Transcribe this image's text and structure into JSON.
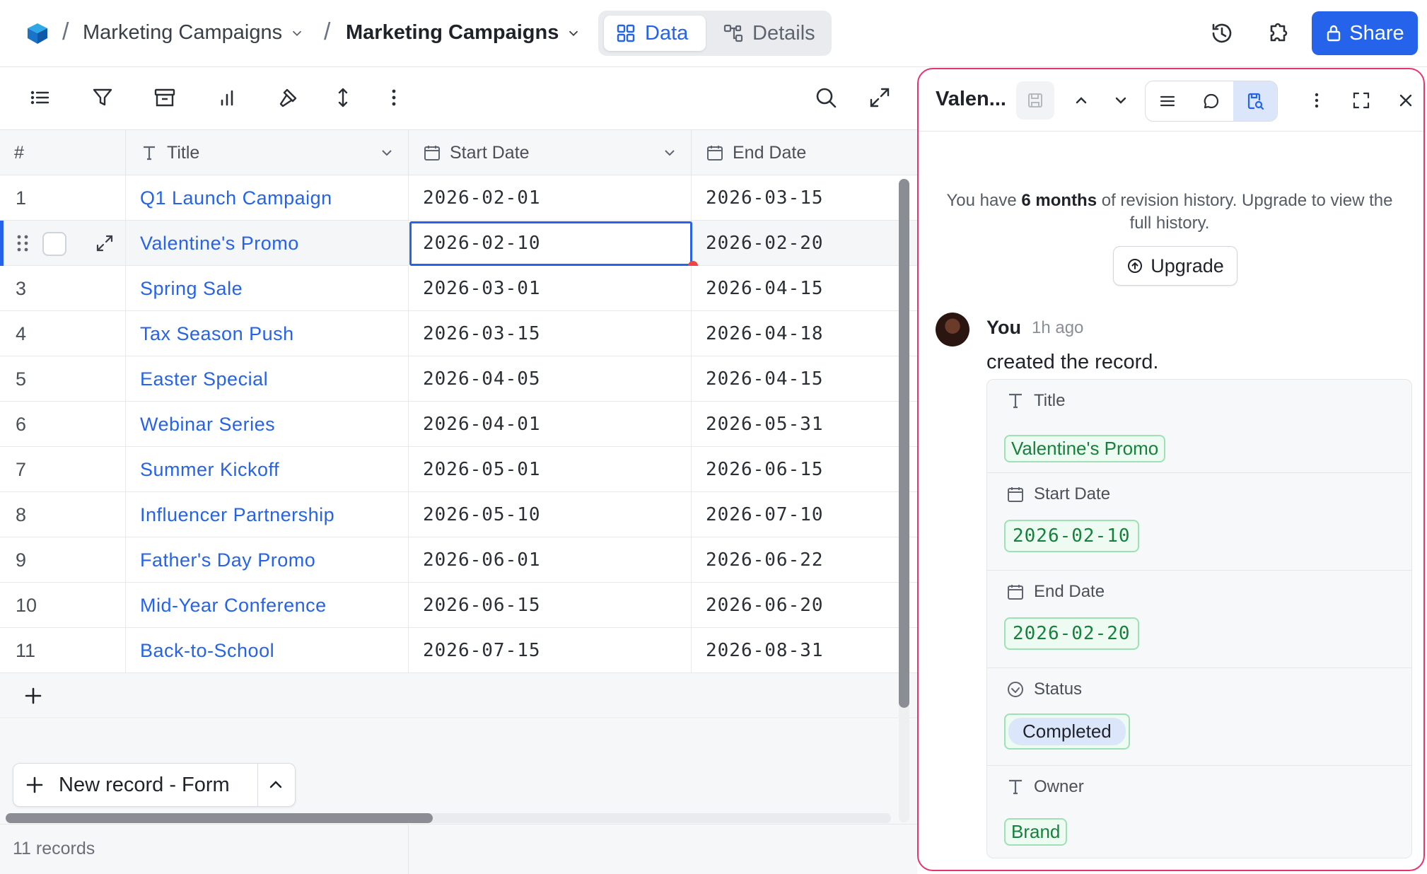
{
  "breadcrumb": {
    "base": "Marketing Campaigns",
    "table": "Marketing Campaigns"
  },
  "view_tabs": [
    {
      "label": "Data",
      "active": true
    },
    {
      "label": "Details",
      "active": false
    }
  ],
  "header_actions": {
    "share_label": "Share"
  },
  "colors": {
    "accent": "#2563eb",
    "panel_border": "#e8336f",
    "tag_green": "#16803c",
    "selection_dot": "#ef4444"
  },
  "toolbar_icons": [
    "fields-icon",
    "filter-icon",
    "group-icon",
    "chart-icon",
    "build-icon",
    "sort-icon",
    "more-icon",
    "search-icon",
    "fullscreen-icon"
  ],
  "columns": [
    {
      "key": "num",
      "label": "#"
    },
    {
      "key": "title",
      "label": "Title"
    },
    {
      "key": "start",
      "label": "Start Date"
    },
    {
      "key": "end",
      "label": "End Date"
    }
  ],
  "rows": [
    {
      "num": "1",
      "title": "Q1 Launch Campaign",
      "start": "2026-02-01",
      "end": "2026-03-15"
    },
    {
      "num": "2",
      "title": "Valentine's Promo",
      "start": "2026-02-10",
      "end": "2026-02-20"
    },
    {
      "num": "3",
      "title": "Spring Sale",
      "start": "2026-03-01",
      "end": "2026-04-15"
    },
    {
      "num": "4",
      "title": "Tax Season Push",
      "start": "2026-03-15",
      "end": "2026-04-18"
    },
    {
      "num": "5",
      "title": "Easter Special",
      "start": "2026-04-05",
      "end": "2026-04-15"
    },
    {
      "num": "6",
      "title": "Webinar Series",
      "start": "2026-04-01",
      "end": "2026-05-31"
    },
    {
      "num": "7",
      "title": "Summer Kickoff",
      "start": "2026-05-01",
      "end": "2026-06-15"
    },
    {
      "num": "8",
      "title": "Influencer Partnership",
      "start": "2026-05-10",
      "end": "2026-07-10"
    },
    {
      "num": "9",
      "title": "Father's Day Promo",
      "start": "2026-06-01",
      "end": "2026-06-22"
    },
    {
      "num": "10",
      "title": "Mid-Year Conference",
      "start": "2026-06-15",
      "end": "2026-06-20"
    },
    {
      "num": "11",
      "title": "Back-to-School",
      "start": "2026-07-15",
      "end": "2026-08-31"
    }
  ],
  "selected_row": 2,
  "new_record_label": "New record - Form",
  "footer": {
    "record_count": "11 records"
  },
  "panel": {
    "title": "Valen...",
    "revision_note_pre": "You have ",
    "revision_note_bold": "6 months",
    "revision_note_post": " of revision history. Upgrade to view the full history.",
    "upgrade_label": "Upgrade",
    "activity": {
      "user": "You",
      "time": "1h ago",
      "action": "created the record."
    },
    "changes": [
      {
        "field": "Title",
        "icon": "text-icon",
        "value": "Valentine's Promo"
      },
      {
        "field": "Start Date",
        "icon": "calendar-icon",
        "value": "2026-02-10"
      },
      {
        "field": "End Date",
        "icon": "calendar-icon",
        "value": "2026-02-20"
      },
      {
        "field": "Status",
        "icon": "status-icon",
        "value": "Completed"
      },
      {
        "field": "Owner",
        "icon": "text-icon",
        "value": "Brand"
      }
    ]
  }
}
